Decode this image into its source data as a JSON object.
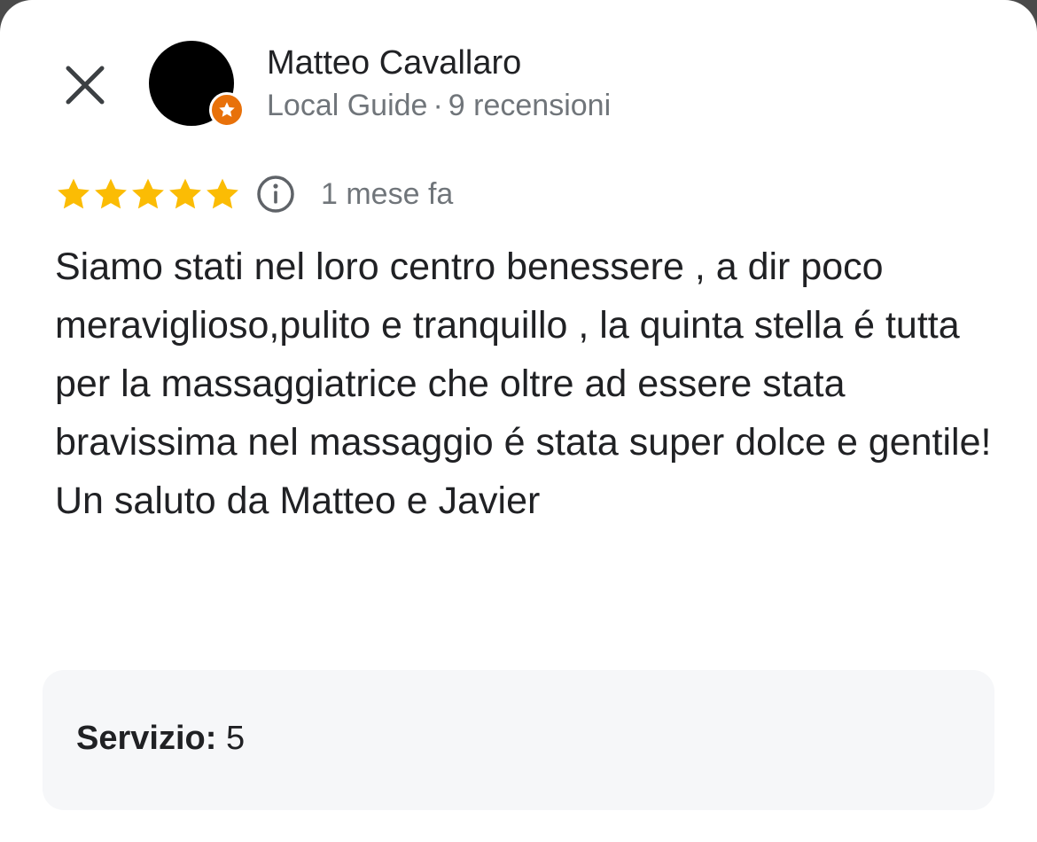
{
  "header": {
    "close_icon": "close-icon",
    "author_name": "Matteo Cavallaro",
    "author_level": "Local Guide",
    "separator": "·",
    "review_count": "9 recensioni",
    "badge_icon": "local-guide-star-icon",
    "badge_color": "#e8710a"
  },
  "review": {
    "rating": 5,
    "rating_max": 5,
    "star_color": "#fbbc04",
    "info_icon": "info-icon",
    "date": "1 mese fa",
    "text": "Siamo stati nel loro centro benessere , a dir poco meraviglioso,pulito e tranquillo , la quinta stella é tutta per la massaggiatrice che oltre ad essere stata bravissima nel massaggio é stata super dolce e gentile!\nUn saluto da Matteo e Javier"
  },
  "ratings_card": {
    "service_label": "Servizio:",
    "service_value": "5"
  }
}
